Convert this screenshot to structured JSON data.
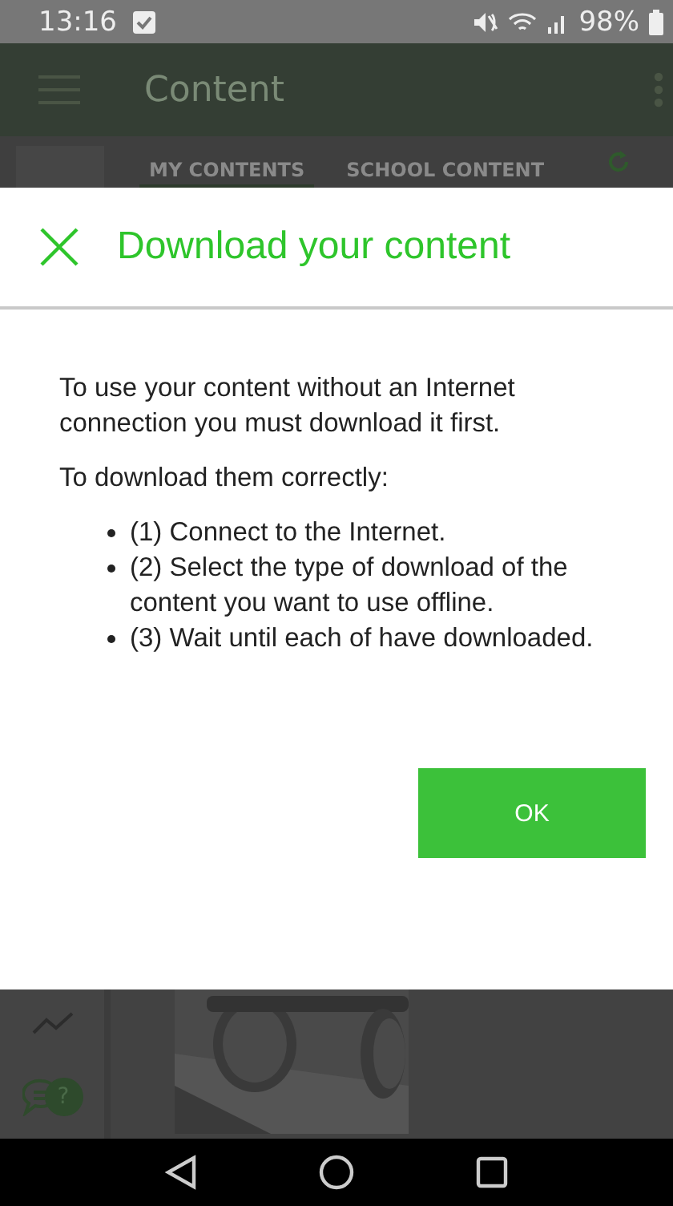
{
  "status_bar": {
    "time": "13:16",
    "battery": "98%"
  },
  "app_bar": {
    "title": "Content"
  },
  "tabs": [
    {
      "label": "MY CONTENTS",
      "selected": true
    },
    {
      "label": "SCHOOL CONTENT",
      "selected": false
    }
  ],
  "dialog": {
    "title": "Download your content",
    "intro": "To use your content without an Internet connection you must download it first.",
    "subtitle": "To download them correctly:",
    "steps": [
      "(1) Connect to the Internet.",
      "(2) Select the type of download of the content you want to use offline.",
      "(3) Wait until each of have downloaded."
    ],
    "button": "OK"
  },
  "help_badge": "?"
}
